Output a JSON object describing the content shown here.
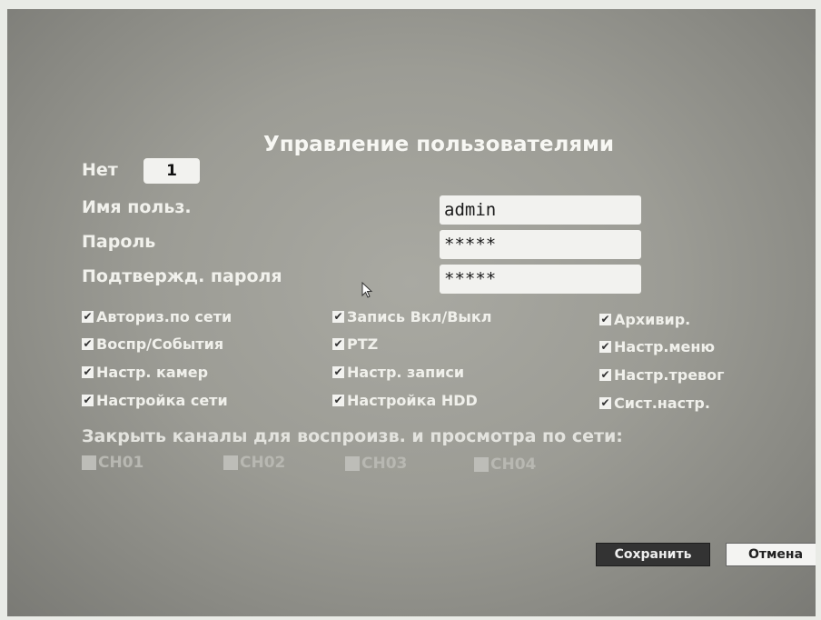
{
  "title": "Управление пользователями",
  "user_number": {
    "label": "Нет",
    "value": "1"
  },
  "username": {
    "label": "Имя польз.",
    "value": "admin"
  },
  "password": {
    "label": "Пароль",
    "value": "*****"
  },
  "confirm_password": {
    "label": "Подтвержд. пароля",
    "value": "*****"
  },
  "permissions": [
    {
      "label": "Авториз.по сети",
      "checked": true
    },
    {
      "label": "Запись Вкл/Выкл",
      "checked": true
    },
    {
      "label": "Архивир.",
      "checked": true
    },
    {
      "label": "Воспр/События",
      "checked": true
    },
    {
      "label": "PTZ",
      "checked": true
    },
    {
      "label": "Настр.меню",
      "checked": true
    },
    {
      "label": "Настр. камер",
      "checked": true
    },
    {
      "label": "Настр. записи",
      "checked": true
    },
    {
      "label": "Настр.тревог",
      "checked": true
    },
    {
      "label": "Настройка сети",
      "checked": true
    },
    {
      "label": "Настройка HDD",
      "checked": true
    },
    {
      "label": "Сист.настр.",
      "checked": true
    }
  ],
  "close_channels_label": "Закрыть каналы для воспроизв. и просмотра по сети:",
  "channels": [
    {
      "label": "CH01",
      "checked": false
    },
    {
      "label": "CH02",
      "checked": false
    },
    {
      "label": "CH03",
      "checked": false
    },
    {
      "label": "CH04",
      "checked": false
    }
  ],
  "buttons": {
    "save": "Сохранить",
    "cancel": "Отмена"
  },
  "checkmark": "✔"
}
